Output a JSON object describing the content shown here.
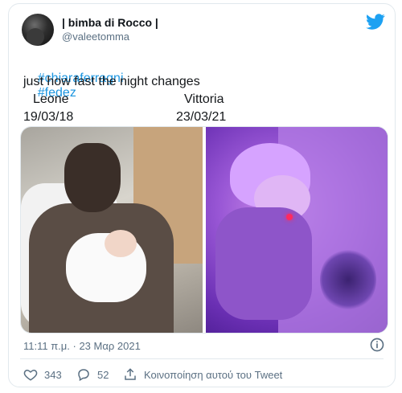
{
  "tweet": {
    "display_name": "| bimba di Rocco |",
    "handle": "@valeetomma",
    "hashtags": [
      "#chiaraferragni",
      "#fedez"
    ],
    "line2": "just how fast the night changes",
    "line3_left": "Leone",
    "line3_right": "Vittoria",
    "line4_left": "19/03/18",
    "line4_right": "23/03/21",
    "timestamp": "11:11 π.μ. · 23 Μαρ 2021",
    "likes": "343",
    "replies": "52",
    "share_label": "Κοινοποίηση αυτού του Tweet"
  },
  "icons": {
    "brand": "twitter-bird-icon",
    "info": "info-icon",
    "like": "heart-icon",
    "reply": "reply-bubble-icon",
    "share": "share-icon"
  },
  "colors": {
    "twitter_blue": "#1da1f2",
    "hashtag": "#1b95e0",
    "secondary_text": "#5b7083"
  }
}
